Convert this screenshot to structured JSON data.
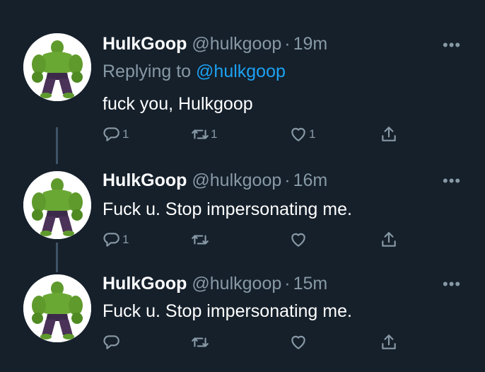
{
  "tweets": [
    {
      "name": "HulkGoop",
      "handle": "@hulkgoop",
      "separator": "·",
      "time": "19m",
      "replying_prefix": "Replying to ",
      "replying_to": "@hulkgoop",
      "text": "fuck you, Hulkgoop",
      "reply_count": "1",
      "retweet_count": "1",
      "like_count": "1"
    },
    {
      "name": "HulkGoop",
      "handle": "@hulkgoop",
      "separator": "·",
      "time": "16m",
      "text": "Fuck u. Stop impersonating me.",
      "reply_count": "1",
      "retweet_count": "",
      "like_count": ""
    },
    {
      "name": "HulkGoop",
      "handle": "@hulkgoop",
      "separator": "·",
      "time": "15m",
      "text": "Fuck u. Stop impersonating me.",
      "reply_count": "",
      "retweet_count": "",
      "like_count": ""
    }
  ],
  "icons": {
    "more": "more-icon",
    "reply": "reply-icon",
    "retweet": "retweet-icon",
    "like": "heart-icon",
    "share": "share-icon"
  },
  "colors": {
    "background": "#15202b",
    "secondary_text": "#8899a6",
    "link": "#1da1f2",
    "thread_line": "#3d5466"
  }
}
